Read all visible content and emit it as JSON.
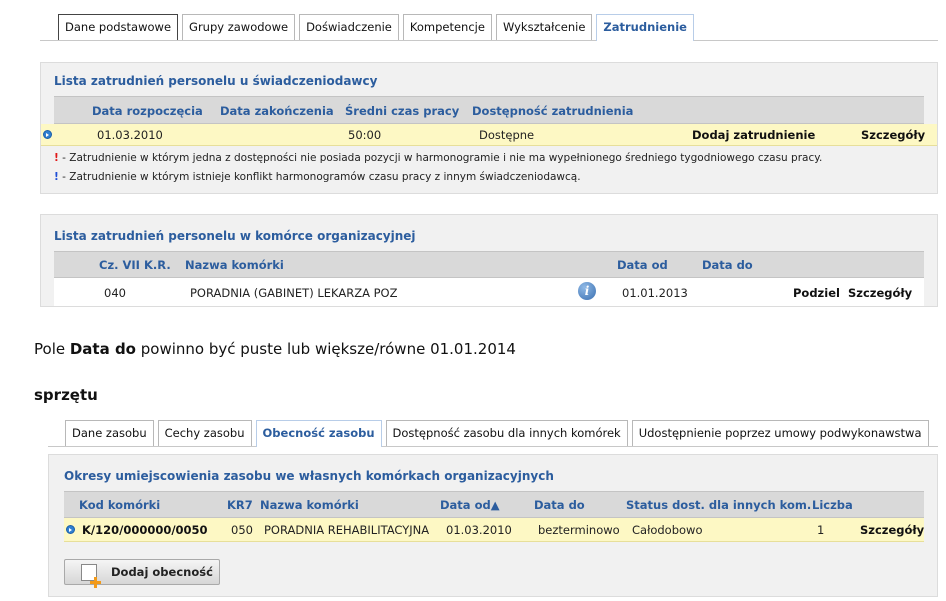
{
  "top_tabs": [
    {
      "label": "Dane podstawowe"
    },
    {
      "label": "Grupy zawodowe"
    },
    {
      "label": "Doświadczenie"
    },
    {
      "label": "Kompetencje"
    },
    {
      "label": "Wykształcenie"
    },
    {
      "label": "Zatrudnienie"
    }
  ],
  "provider_panel": {
    "title": "Lista zatrudnień personelu u świadczeniodawcy",
    "columns": [
      "Data rozpoczęcia",
      "Data zakończenia",
      "Średni czas pracy",
      "Dostępność zatrudnienia"
    ],
    "row": {
      "start": "01.03.2010",
      "end": "",
      "avg_time": "50:00",
      "availability": "Dostępne",
      "add_label": "Dodaj zatrudnienie",
      "details_label": "Szczegóły"
    },
    "legend": [
      {
        "mark": "!",
        "color": "#e01818",
        "text": " - Zatrudnienie w którym jedna z dostępności nie posiada pozycji w harmonogramie i nie ma wypełnionego średniego tygodniowego czasu pracy."
      },
      {
        "mark": "!",
        "color": "#1f4fd6",
        "text": " - Zatrudnienie w którym istnieje konflikt harmonogramów czasu pracy z innym świadczeniodawcą."
      }
    ]
  },
  "cell_panel": {
    "title": "Lista zatrudnień personelu w komórce organizacyjnej",
    "columns": [
      "Cz. VII K.R.",
      "Nazwa komórki",
      "Data od",
      "Data do"
    ],
    "row": {
      "code": "040",
      "name": "PORADNIA (GABINET) LEKARZA POZ",
      "date_from": "01.01.2013",
      "date_to": "",
      "split_label": "Podziel",
      "details_label": "Szczegóły"
    }
  },
  "note": {
    "prefix": "Pole ",
    "field": "Data do",
    "suffix": " powinno być puste lub większe/równe 01.01.2014"
  },
  "heading2": "sprzętu",
  "bottom_tabs": [
    {
      "label": "Dane zasobu"
    },
    {
      "label": "Cechy zasobu"
    },
    {
      "label": "Obecność zasobu"
    },
    {
      "label": "Dostępność zasobu dla innych komórek"
    },
    {
      "label": "Udostępnienie poprzez umowy podwykonawstwa"
    }
  ],
  "resource_panel": {
    "title": "Okresy umiejscowienia zasobu we własnych komórkach organizacyjnych",
    "columns": [
      "Kod komórki",
      "KR7",
      "Nazwa komórki",
      "Data od▲",
      "Data do",
      "Status dost. dla innych kom.",
      "Liczba"
    ],
    "row": {
      "code": "K/120/000000/0050",
      "kr7": "050",
      "name": "PORADNIA REHABILITACYJNA",
      "date_from": "01.03.2010",
      "date_to": "bezterminowo",
      "status": "Całodobowo",
      "count": "1",
      "details_label": "Szczegóły"
    },
    "add_button_label": "Dodaj obecność"
  },
  "colors": {
    "link": "#2c5d9e",
    "highlight_row": "#fdf8c4",
    "header_bg": "#d9d9d9",
    "panel_bg": "#f1f1f1"
  }
}
